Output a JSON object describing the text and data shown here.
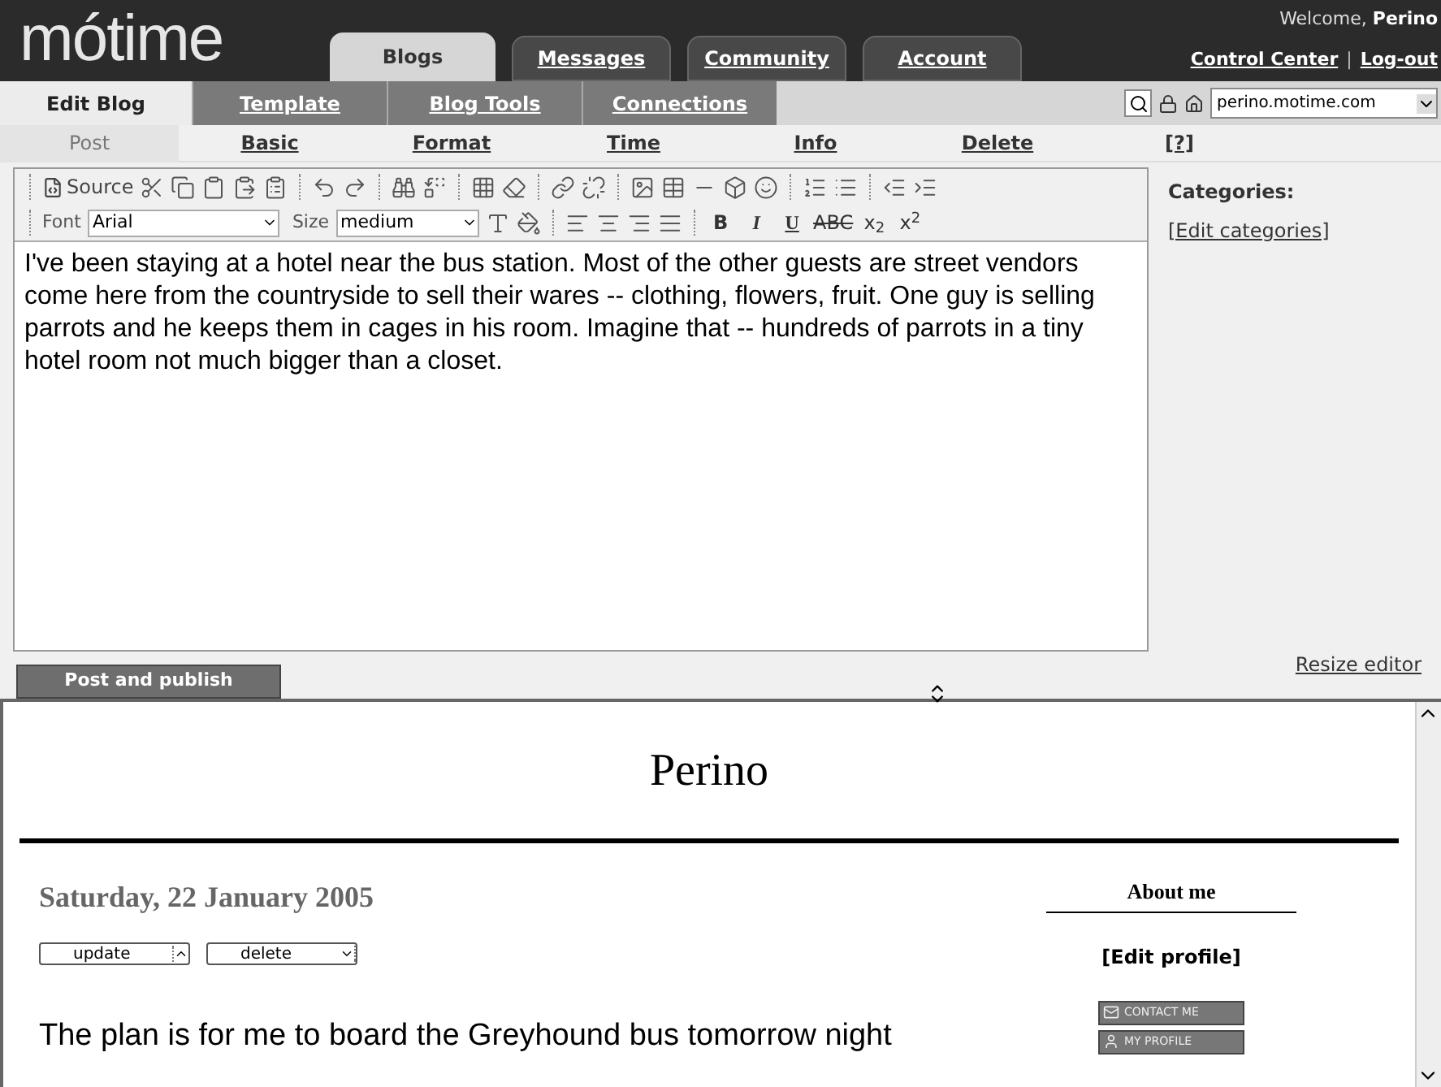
{
  "logo": "mótime",
  "welcome": {
    "prefix": "Welcome,",
    "name": "Perino"
  },
  "user_links": [
    "Control Center",
    "Log-out"
  ],
  "link_separator": "|",
  "main_tabs": [
    {
      "label": "Blogs",
      "selected": true
    },
    {
      "label": "Messages",
      "selected": false
    },
    {
      "label": "Community",
      "selected": false
    },
    {
      "label": "Account",
      "selected": false
    }
  ],
  "sub_tabs": [
    {
      "label": "Edit Blog",
      "selected": true
    },
    {
      "label": "Template",
      "selected": false
    },
    {
      "label": "Blog Tools",
      "selected": false
    },
    {
      "label": "Connections",
      "selected": false
    }
  ],
  "blog_select": {
    "value": "perino.motime.com"
  },
  "edit_tabs": [
    {
      "label": "Post",
      "selected": true
    },
    {
      "label": "Basic",
      "selected": false
    },
    {
      "label": "Format",
      "selected": false
    },
    {
      "label": "Time",
      "selected": false
    },
    {
      "label": "Info",
      "selected": false
    },
    {
      "label": "Delete",
      "selected": false
    },
    {
      "label": "[?]",
      "selected": false
    }
  ],
  "toolbar": {
    "source_label": "Source",
    "font_label": "Font",
    "font_value": "Arial",
    "size_label": "Size",
    "size_value": "medium",
    "format_buttons": [
      {
        "kind": "bold",
        "label": "B"
      },
      {
        "kind": "italic",
        "label": "I"
      },
      {
        "kind": "underline",
        "label": "U"
      },
      {
        "kind": "strike",
        "label": "ABC"
      },
      {
        "kind": "sub",
        "label": "x$_{2}$"
      },
      {
        "kind": "sup",
        "label": "x$^{2}$"
      }
    ]
  },
  "editor_text": "I've been staying at a hotel near the bus station. Most of the other guests are street vendors come here from the countryside to sell their wares -- clothing, flowers, fruit. One guy is selling parrots and he keeps them in cages in his room. Imagine that -- hundreds of parrots in a tiny hotel room not much bigger than a closet.",
  "categories": {
    "label": "Categories:",
    "link": "[Edit categories]"
  },
  "publish_button": "Post and publish",
  "resize_link": "Resize editor",
  "preview": {
    "blog_title": "Perino",
    "date": "Saturday, 22 January 2005",
    "post_buttons": [
      "update",
      "delete"
    ],
    "post_start": "The plan is for me to board the Greyhound bus tomorrow night",
    "about_title": "About me",
    "edit_profile": "[Edit profile]",
    "badges": [
      "CONTACT ME",
      "MY PROFILE"
    ]
  }
}
